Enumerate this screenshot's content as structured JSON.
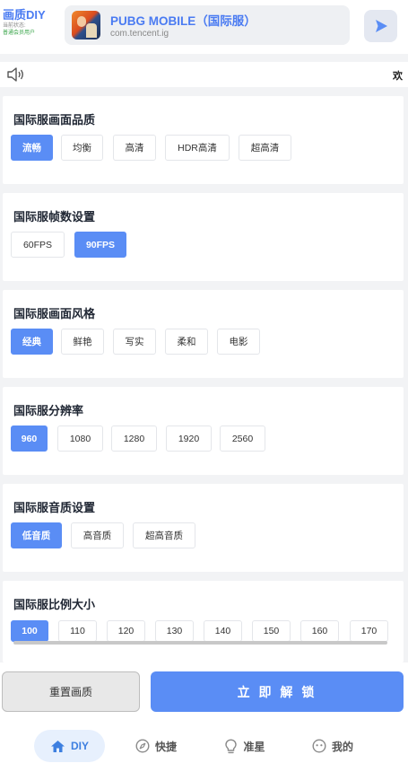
{
  "header": {
    "brand_title": "画质DIY",
    "status_label": "当前状态:",
    "user_status": "普通会员用户"
  },
  "app": {
    "name": "PUBG MOBILE（国际服）",
    "package": "com.tencent.ig"
  },
  "notice": {
    "text": "欢"
  },
  "sections": {
    "quality": {
      "title": "国际服画面品质",
      "options": [
        "流畅",
        "均衡",
        "高清",
        "HDR高清",
        "超高清"
      ],
      "selected": "流畅"
    },
    "fps": {
      "title": "国际服帧数设置",
      "options": [
        "60FPS",
        "90FPS"
      ],
      "selected": "90FPS"
    },
    "style": {
      "title": "国际服画面风格",
      "options": [
        "经典",
        "鲜艳",
        "写实",
        "柔和",
        "电影"
      ],
      "selected": "经典"
    },
    "resolution": {
      "title": "国际服分辨率",
      "options": [
        "960",
        "1080",
        "1280",
        "1920",
        "2560"
      ],
      "selected": "960"
    },
    "audio": {
      "title": "国际服音质设置",
      "options": [
        "低音质",
        "高音质",
        "超高音质"
      ],
      "selected": "低音质"
    },
    "scale": {
      "title": "国际服比例大小",
      "options": [
        "100",
        "110",
        "120",
        "130",
        "140",
        "150",
        "160",
        "170"
      ],
      "selected": "100"
    }
  },
  "actions": {
    "reset": "重置画质",
    "unlock": "立 即 解 锁"
  },
  "tabs": [
    "DIY",
    "快捷",
    "准星",
    "我的"
  ],
  "colors": {
    "accent": "#5a8df5",
    "brand_text": "#4a7bf2",
    "user_status": "#3aa54a"
  }
}
